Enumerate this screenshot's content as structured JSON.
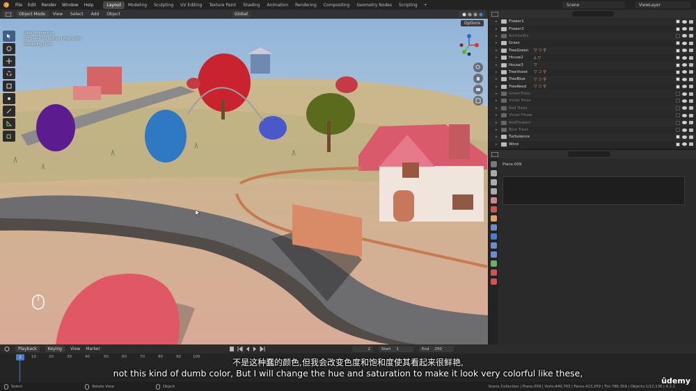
{
  "topbar": {
    "menus": [
      "File",
      "Edit",
      "Render",
      "Window",
      "Help"
    ],
    "workspaces": [
      "Layout",
      "Modeling",
      "Sculpting",
      "UV Editing",
      "Texture Paint",
      "Shading",
      "Animation",
      "Rendering",
      "Compositing",
      "Geometry Nodes",
      "Scripting"
    ],
    "active_workspace": "Layout",
    "add_tab": "+",
    "scene": "Scene",
    "view_layer": "ViewLayer"
  },
  "viewport": {
    "mode": "Object Mode",
    "menus": [
      "View",
      "Select",
      "Add",
      "Object"
    ],
    "orientation": "Global",
    "options": "Options",
    "info_lines": [
      "User Perspective",
      "(2) Scene Collection | Plane.009",
      "Rendering Done"
    ]
  },
  "outliner": {
    "rows": [
      {
        "name": "Flower1",
        "dim": false,
        "mods": "",
        "on": true
      },
      {
        "name": "Flower2",
        "dim": false,
        "mods": "",
        "on": true
      },
      {
        "name": "ArchiveEls",
        "dim": true,
        "mods": "",
        "on": false
      },
      {
        "name": "Grass",
        "dim": false,
        "mods": "",
        "on": true
      },
      {
        "name": "TreeGreen",
        "dim": false,
        "mods": "▽ ⊃ ⚲",
        "on": true
      },
      {
        "name": "House2",
        "dim": false,
        "mods": "⅄ ▽",
        "on": true
      },
      {
        "name": "House3",
        "dim": false,
        "mods": "▽",
        "on": true
      },
      {
        "name": "TreeViolet",
        "dim": false,
        "mods": "▽ ⊃ ⚲",
        "on": true
      },
      {
        "name": "TreeBlue",
        "dim": false,
        "mods": "▽ ⊃ ⚲",
        "on": true
      },
      {
        "name": "TreeReed",
        "dim": false,
        "mods": "▽ ⊃ ⚲",
        "on": true
      },
      {
        "name": "GreenTrees",
        "dim": true,
        "mods": "",
        "on": false
      },
      {
        "name": "Violet Trees",
        "dim": true,
        "mods": "",
        "on": false
      },
      {
        "name": "Red Trees",
        "dim": true,
        "mods": "",
        "on": false
      },
      {
        "name": "Violet Flowers",
        "dim": true,
        "mods": "",
        "on": false
      },
      {
        "name": "RedFlowers",
        "dim": true,
        "mods": "",
        "on": false
      },
      {
        "name": "Blue Trees",
        "dim": true,
        "mods": "",
        "on": false
      },
      {
        "name": "Turbulence",
        "dim": false,
        "mods": "",
        "on": true
      },
      {
        "name": "Wind",
        "dim": false,
        "mods": "",
        "on": true
      }
    ]
  },
  "properties": {
    "object_name": "Plane.009"
  },
  "timeline": {
    "menus": [
      "Playback",
      "Keying",
      "View",
      "Marker"
    ],
    "current_frame": "2",
    "start_label": "Start",
    "start": "1",
    "end_label": "End",
    "end": "250",
    "ticks": [
      "10",
      "20",
      "30",
      "40",
      "50",
      "60",
      "70",
      "80",
      "90",
      "100"
    ]
  },
  "statusbar": {
    "select": "Select",
    "rotate": "Rotate View",
    "object": "Object",
    "stats": "Scene Collection | Plane.009 | Verts:449,703 | Faces:413,259 | Tris:786,359 | Objects:1/12,136 | 4.2.2"
  },
  "subtitles": {
    "zh": "不是这种蠢的颜色,但我会改变色度和饱和度使其看起来很鲜艳,",
    "en": "not this kind of dumb color, But I will change the hue and saturation to make it look very colorful like these,"
  },
  "brand": "ûdemy",
  "colors": {
    "accent_blue": "#4a7cc9",
    "active_tab": "#4a4a4a",
    "modifier_orange": "#e8a060"
  }
}
